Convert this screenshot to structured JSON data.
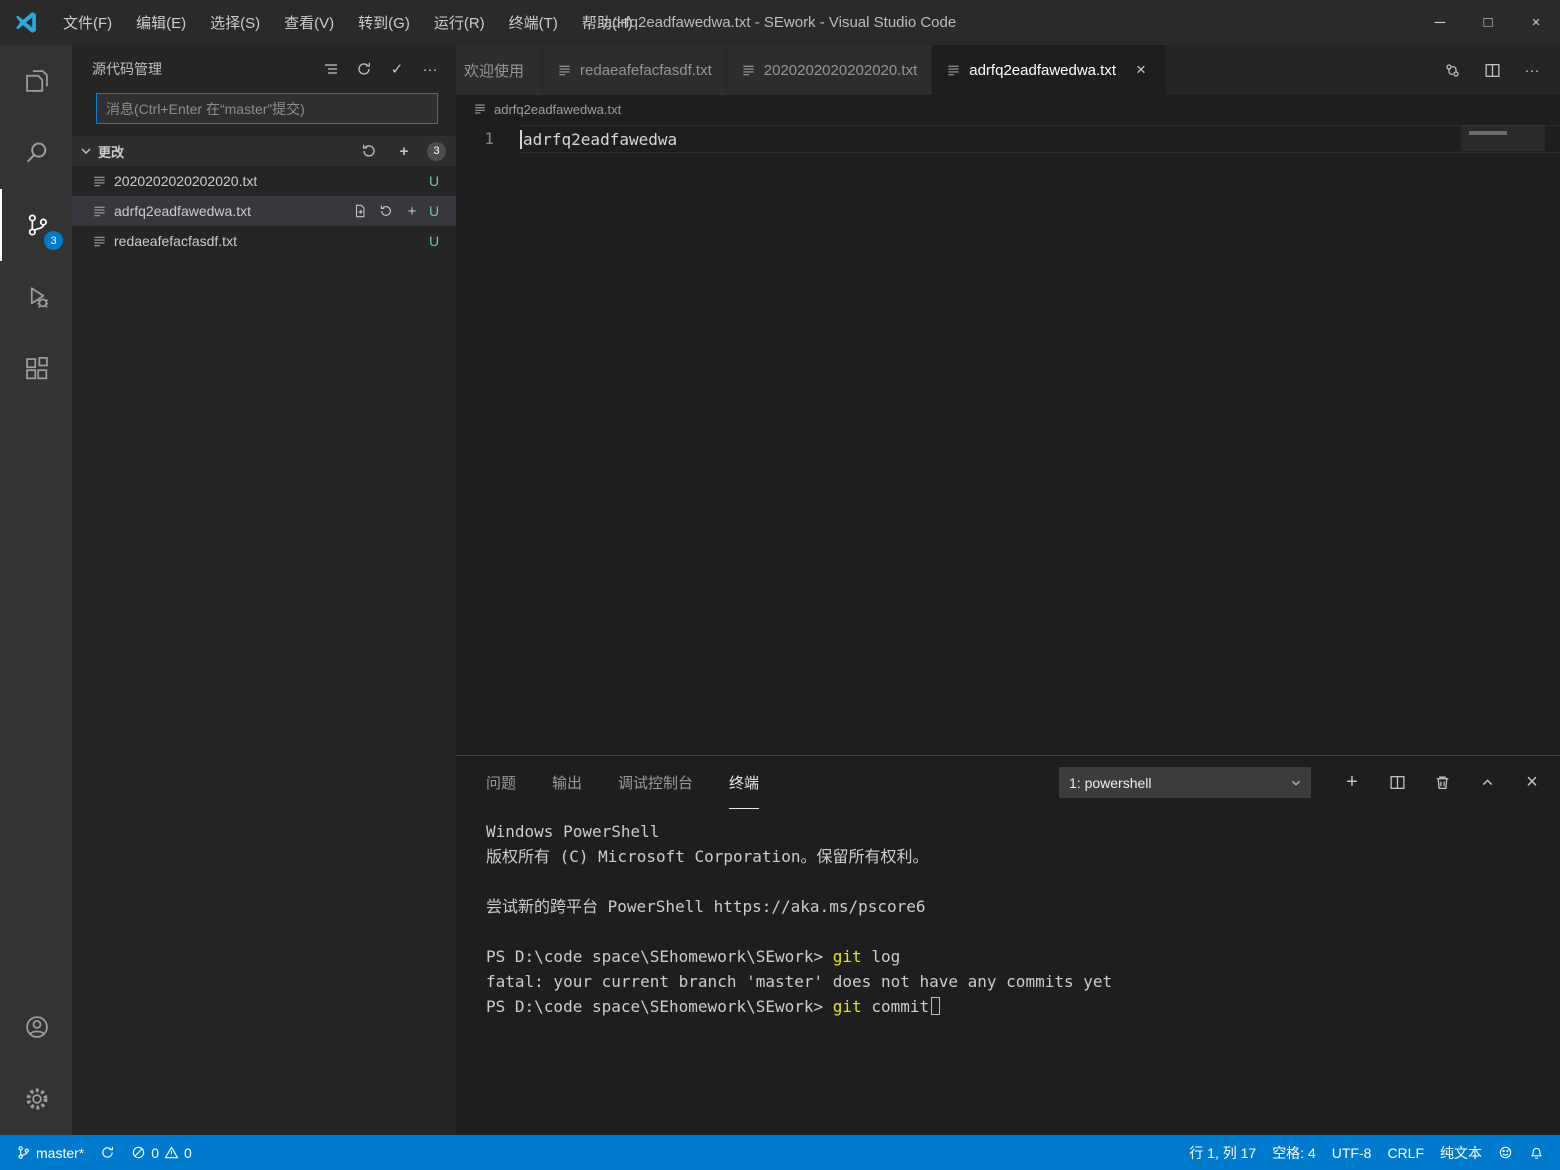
{
  "icons": {
    "check": "✓",
    "add": "+",
    "more": "···",
    "close": "×",
    "minimize": "─",
    "maximize": "□"
  },
  "titlebar": {
    "menus": [
      "文件(F)",
      "编辑(E)",
      "选择(S)",
      "查看(V)",
      "转到(G)",
      "运行(R)",
      "终端(T)",
      "帮助(H)"
    ],
    "title": "adrfq2eadfawedwa.txt - SEwork - Visual Studio Code"
  },
  "activity_bar": {
    "scm_badge": "3"
  },
  "sidebar": {
    "title": "源代码管理",
    "commit_placeholder": "消息(Ctrl+Enter 在“master”提交)",
    "changes": {
      "label": "更改",
      "badge": "3",
      "files": [
        {
          "name": "2020202020202020.txt",
          "status": "U"
        },
        {
          "name": "adrfq2eadfawedwa.txt",
          "status": "U"
        },
        {
          "name": "redaeafefacfasdf.txt",
          "status": "U"
        }
      ]
    }
  },
  "editor": {
    "tabs": [
      {
        "label": "欢迎使用"
      },
      {
        "label": "redaeafefacfasdf.txt"
      },
      {
        "label": "2020202020202020.txt"
      },
      {
        "label": "adrfq2eadfawedwa.txt"
      }
    ],
    "breadcrumb": "adrfq2eadfawedwa.txt",
    "line_number": "1",
    "line_text": "adrfq2eadfawedwa"
  },
  "panel": {
    "tabs": [
      "问题",
      "输出",
      "调试控制台",
      "终端"
    ],
    "terminal_selector": "1: powershell",
    "terminal": {
      "banner1": "Windows PowerShell",
      "banner2": "版权所有 (C) Microsoft Corporation。保留所有权利。",
      "pscore": "尝试新的跨平台 PowerShell https://aka.ms/pscore6",
      "prompt": "PS D:\\code space\\SEhomework\\SEwork> ",
      "cmd_git": "git",
      "cmd1_args": " log",
      "fatal": "fatal: your current branch 'master' does not have any commits yet",
      "cmd2_args": " commit"
    }
  },
  "statusbar": {
    "branch": "master*",
    "errors": "0",
    "warnings": "0",
    "cursor_position": "行 1, 列 17",
    "indentation": "空格: 4",
    "encoding": "UTF-8",
    "eol": "CRLF",
    "language": "纯文本"
  },
  "colors": {
    "accent": "#007acc",
    "untracked_green": "#73c991",
    "command_yellow": "#e5e510",
    "focus_border": "#007fd4"
  }
}
